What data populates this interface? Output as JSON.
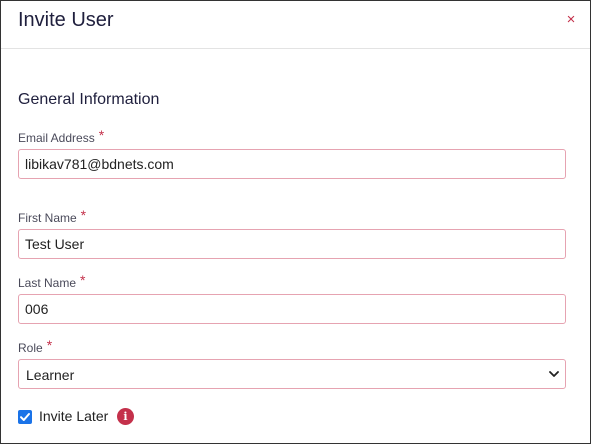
{
  "dialog": {
    "title": "Invite User",
    "close_icon": "×"
  },
  "section": {
    "title": "General Information"
  },
  "fields": {
    "email": {
      "label": "Email Address",
      "required_mark": "*",
      "value": "libikav781@bdnets.com"
    },
    "first_name": {
      "label": "First Name",
      "required_mark": "*",
      "value": "Test User"
    },
    "last_name": {
      "label": "Last Name",
      "required_mark": "*",
      "value": "006"
    },
    "role": {
      "label": "Role",
      "required_mark": "*",
      "value": "Learner"
    }
  },
  "invite_later": {
    "label": "Invite Later",
    "checked": true,
    "info_icon": "i"
  },
  "colors": {
    "accent": "#c4314b",
    "input_border": "#e6a3b1",
    "checkbox": "#1a73e8"
  }
}
